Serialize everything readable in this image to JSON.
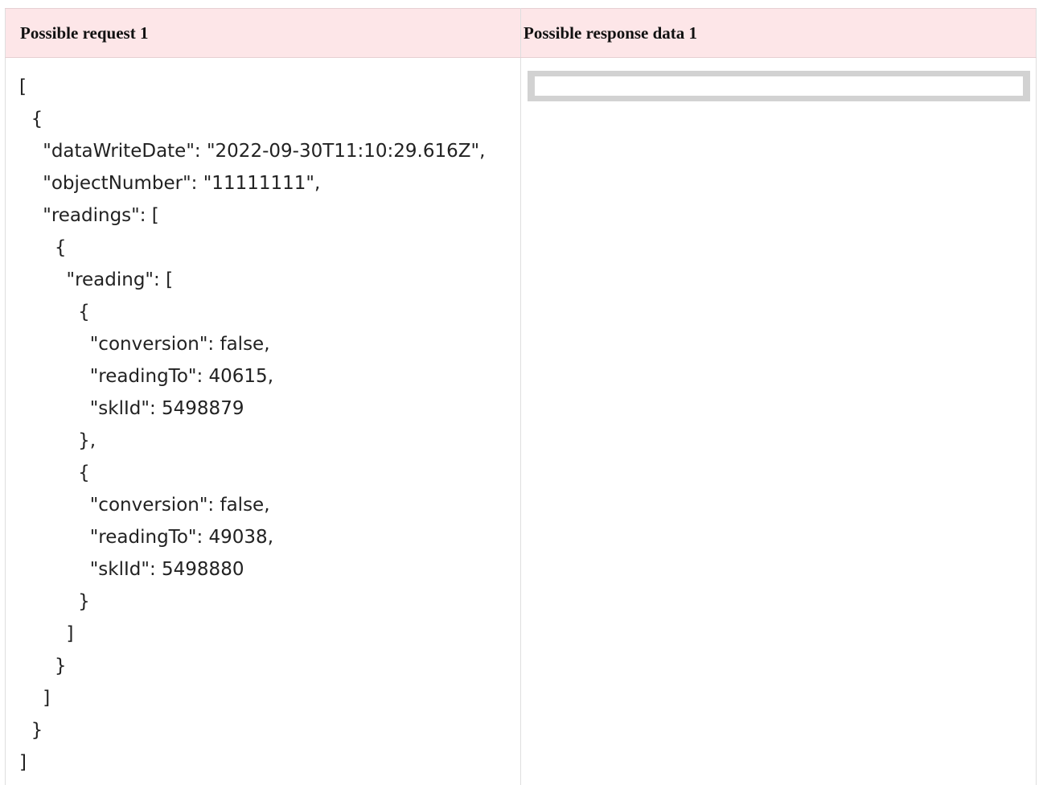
{
  "table": {
    "headers": {
      "request": "Possible request 1",
      "response": "Possible response data 1"
    },
    "request_lines": [
      "[",
      "  {",
      "    \"dataWriteDate\": \"2022-09-30T11:10:29.616Z\",",
      "    \"objectNumber\": \"11111111\",",
      "    \"readings\": [",
      "      {",
      "        \"reading\": [",
      "          {",
      "            \"conversion\": false,",
      "            \"readingTo\": 40615,",
      "            \"sklId\": 5498879",
      "          },",
      "          {",
      "            \"conversion\": false,",
      "            \"readingTo\": 49038,",
      "            \"sklId\": 5498880",
      "          }",
      "        ]",
      "      }",
      "    ]",
      "  }",
      "]"
    ],
    "response_body": ""
  }
}
